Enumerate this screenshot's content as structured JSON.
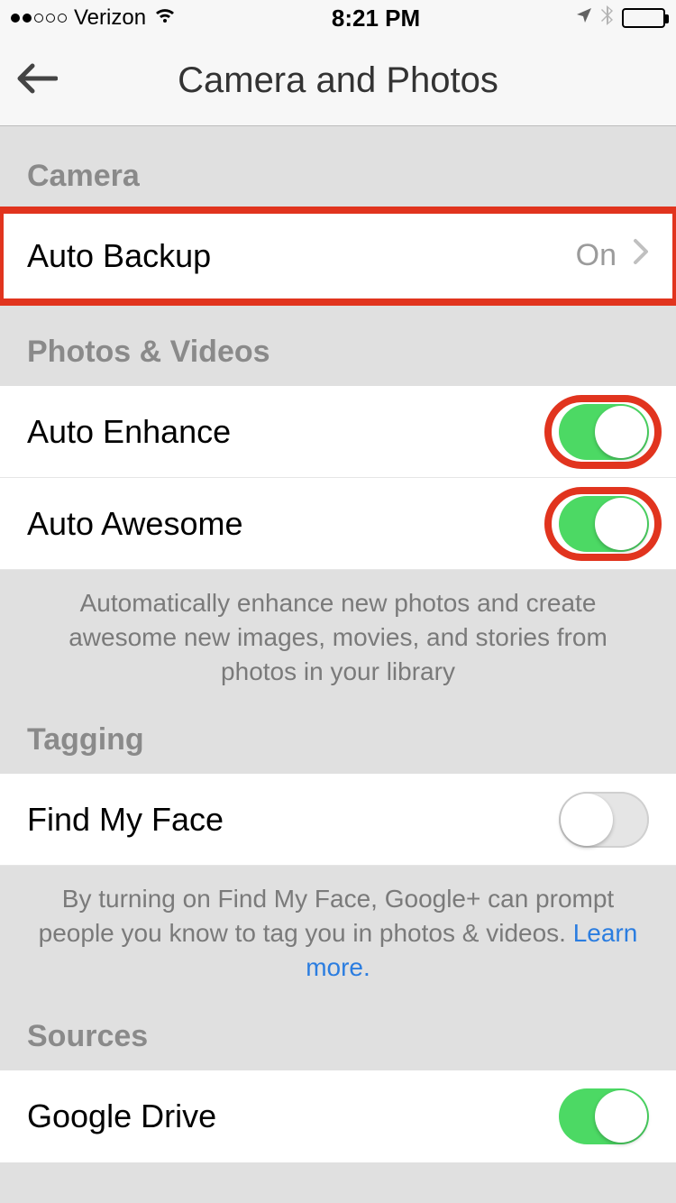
{
  "status": {
    "carrier": "Verizon",
    "time": "8:21 PM"
  },
  "header": {
    "title": "Camera and Photos"
  },
  "sections": {
    "camera": {
      "title": "Camera",
      "auto_backup": {
        "label": "Auto Backup",
        "value": "On"
      }
    },
    "photos_videos": {
      "title": "Photos & Videos",
      "auto_enhance": {
        "label": "Auto Enhance",
        "on": true
      },
      "auto_awesome": {
        "label": "Auto Awesome",
        "on": true
      },
      "footer": "Automatically enhance new photos and create awesome new images, movies, and stories from photos in your library"
    },
    "tagging": {
      "title": "Tagging",
      "find_my_face": {
        "label": "Find My Face",
        "on": false
      },
      "footer_pre": "By turning on Find My Face, Google+ can prompt people you know to tag you in photos & videos. ",
      "footer_link": "Learn more."
    },
    "sources": {
      "title": "Sources",
      "google_drive": {
        "label": "Google Drive",
        "on": true
      }
    }
  }
}
